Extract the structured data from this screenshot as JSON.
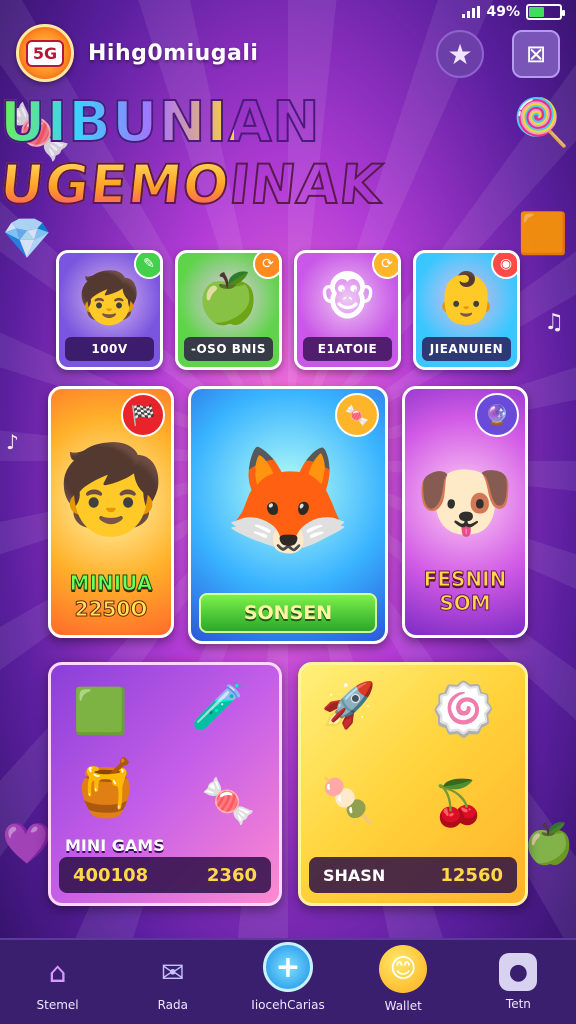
{
  "status_bar": {
    "battery_text": "49%",
    "battery_level": 0.49
  },
  "header": {
    "logo_text": "5G",
    "app_title": "Hihg0miugali",
    "star_icon": "star-icon",
    "stats_icon": "stats-icon"
  },
  "hero": {
    "line1": "UIBUNIAN",
    "line2": "UGEMOINAK"
  },
  "small_cards": [
    {
      "label": "100V",
      "art": "🧒",
      "badge": "✎",
      "color": "#7a56e0",
      "badge_color": "#43d04a"
    },
    {
      "label": "-OSO BNIS",
      "art": "🍏",
      "badge": "⟳",
      "color": "#5fd44a",
      "badge_color": "#ff8a1f"
    },
    {
      "label": "E1ATOIE",
      "art": "🐵",
      "badge": "⟳",
      "color": "#c957e8",
      "badge_color": "#ffb42a"
    },
    {
      "label": "JIEANUIEN",
      "art": "👶",
      "badge": "◉",
      "color": "#3ac7ff",
      "badge_color": "#ff4a4a"
    }
  ],
  "medium_cards": [
    {
      "name": "MINIUA",
      "score": "2250O",
      "art": "🧒",
      "badge": "🏁"
    },
    {
      "play_label": "SONSEN",
      "art": "🦊",
      "badge": "🍬"
    },
    {
      "name": "FESNIN",
      "score": "SOM",
      "art": "🐶",
      "badge": "🔮"
    }
  ],
  "large_cards": [
    {
      "title": "MINI GAMS",
      "left_value": "400108",
      "right_value": "2360"
    },
    {
      "left_value": "SHASN",
      "right_value": "12560"
    }
  ],
  "nav": [
    {
      "label": "Stemel",
      "icon": "home-icon"
    },
    {
      "label": "Rada",
      "icon": "mail-icon"
    },
    {
      "label": "IiocehCarias",
      "icon": "plus-icon"
    },
    {
      "label": "Wallet",
      "icon": "smiley-icon"
    },
    {
      "label": "Tetn",
      "icon": "team-icon"
    }
  ]
}
